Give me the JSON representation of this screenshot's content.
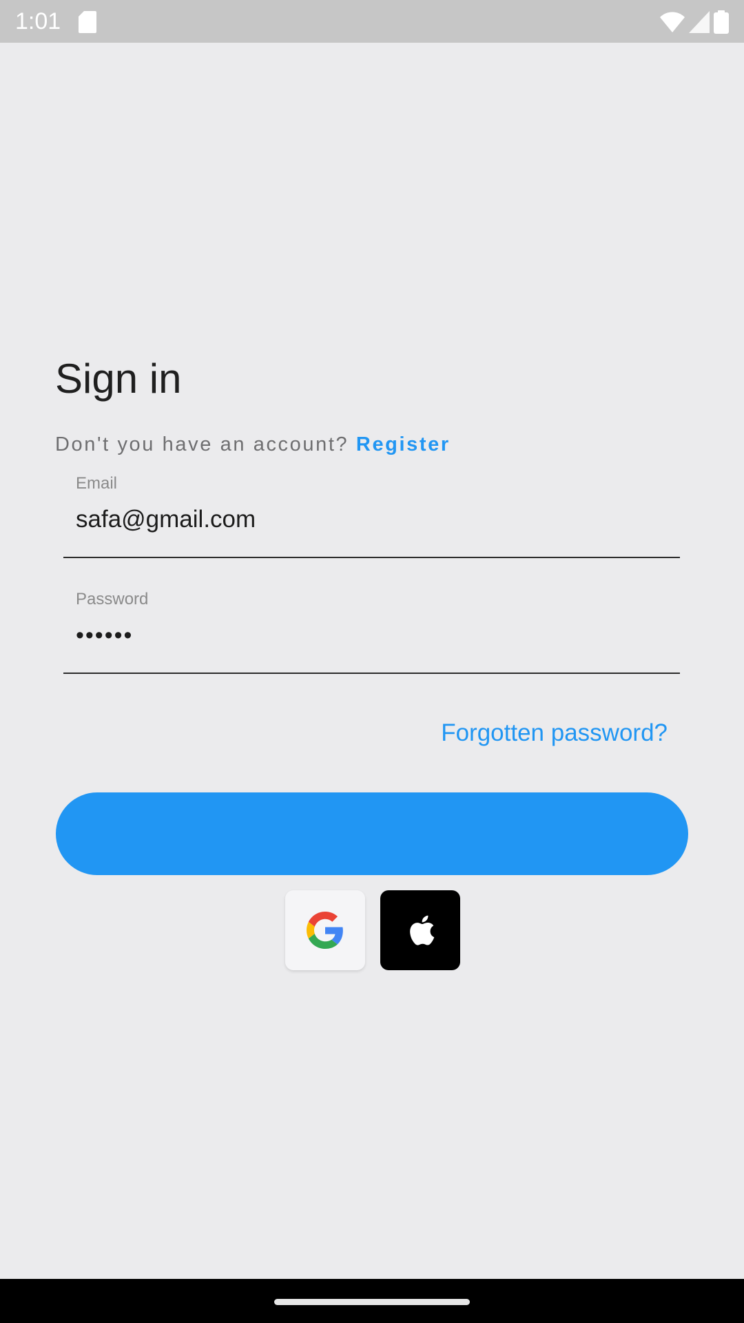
{
  "status_bar": {
    "time": "1:01",
    "icons": [
      "sd-card-icon",
      "wifi-icon",
      "signal-icon",
      "battery-icon"
    ]
  },
  "signin": {
    "title": "Sign in",
    "register_prompt": "Don't you have an account?",
    "register_link": "Register",
    "email": {
      "label": "Email",
      "value": "safa@gmail.com"
    },
    "password": {
      "label": "Password",
      "value": "••••••"
    },
    "forgot_link": "Forgotten password?",
    "social_icons": [
      "google-icon",
      "apple-icon"
    ]
  },
  "colors": {
    "accent": "#2196f3",
    "background": "#ebebed",
    "status_bar": "#c6c6c6",
    "nav_bar": "#000000"
  }
}
